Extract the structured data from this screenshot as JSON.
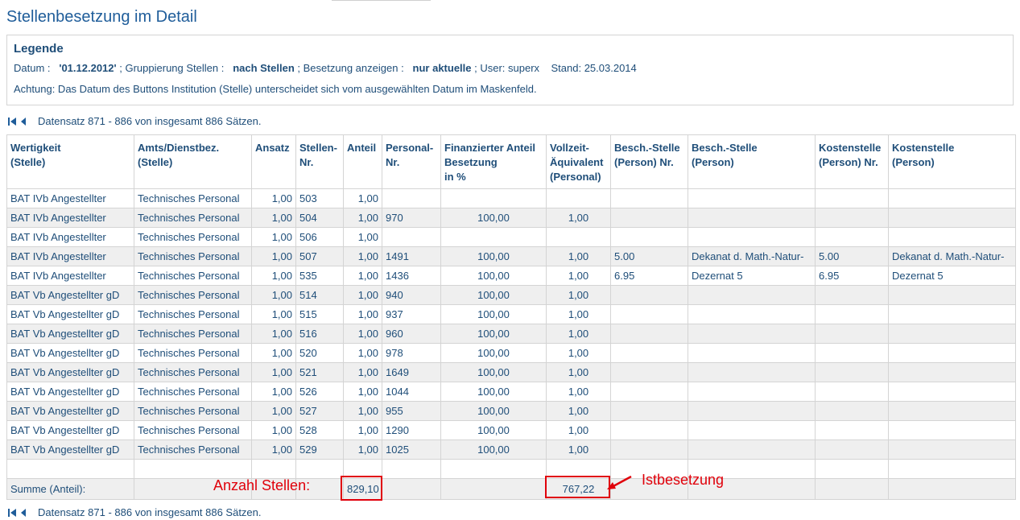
{
  "page": {
    "title": "Stellenbesetzung im Detail"
  },
  "legend": {
    "heading": "Legende",
    "datum_label": "Datum :",
    "datum_value": "'01.12.2012'",
    "sep1": ";",
    "gruppierung_label": "Gruppierung Stellen :",
    "gruppierung_value": "nach Stellen",
    "sep2": ";",
    "besetzung_label": "Besetzung anzeigen :",
    "besetzung_value": "nur aktuelle",
    "user_text": "; User: superx",
    "stand_text": "Stand: 25.03.2014",
    "note": "Achtung: Das Datum des Buttons Institution (Stelle) unterscheidet sich vom ausgewählten Datum im Maskenfeld."
  },
  "pager": {
    "text": "Datensatz 871 - 886 von insgesamt 886 Sätzen."
  },
  "table": {
    "headers": [
      [
        "Wertigkeit",
        "(Stelle)"
      ],
      [
        "Amts/Dienstbez.",
        "(Stelle)"
      ],
      [
        "Ansatz"
      ],
      [
        "Stellen-",
        "Nr."
      ],
      [
        "Anteil"
      ],
      [
        "Personal-",
        "Nr."
      ],
      [
        "Finanzierter Anteil",
        "Besetzung",
        "in %"
      ],
      [
        "Vollzeit-",
        "Äquivalent",
        "(Personal)"
      ],
      [
        "Besch.-Stelle",
        "(Person) Nr."
      ],
      [
        "Besch.-Stelle",
        "(Person)"
      ],
      [
        "Kostenstelle",
        "(Person) Nr."
      ],
      [
        "Kostenstelle",
        "(Person)"
      ]
    ],
    "rows": [
      [
        "BAT IVb Angestellter",
        "Technisches Personal",
        "1,00",
        "503",
        "1,00",
        "",
        "",
        "",
        "",
        "",
        "",
        ""
      ],
      [
        "BAT IVb Angestellter",
        "Technisches Personal",
        "1,00",
        "504",
        "1,00",
        "970",
        "100,00",
        "1,00",
        "",
        "",
        "",
        ""
      ],
      [
        "BAT IVb Angestellter",
        "Technisches Personal",
        "1,00",
        "506",
        "1,00",
        "",
        "",
        "",
        "",
        "",
        "",
        ""
      ],
      [
        "BAT IVb Angestellter",
        "Technisches Personal",
        "1,00",
        "507",
        "1,00",
        "1491",
        "100,00",
        "1,00",
        "5.00",
        "Dekanat d. Math.-Natur-",
        "5.00",
        "Dekanat d. Math.-Natur-"
      ],
      [
        "BAT IVb Angestellter",
        "Technisches Personal",
        "1,00",
        "535",
        "1,00",
        "1436",
        "100,00",
        "1,00",
        "6.95",
        "Dezernat 5",
        "6.95",
        "Dezernat 5"
      ],
      [
        "BAT Vb Angestellter gD",
        "Technisches Personal",
        "1,00",
        "514",
        "1,00",
        "940",
        "100,00",
        "1,00",
        "",
        "",
        "",
        ""
      ],
      [
        "BAT Vb Angestellter gD",
        "Technisches Personal",
        "1,00",
        "515",
        "1,00",
        "937",
        "100,00",
        "1,00",
        "",
        "",
        "",
        ""
      ],
      [
        "BAT Vb Angestellter gD",
        "Technisches Personal",
        "1,00",
        "516",
        "1,00",
        "960",
        "100,00",
        "1,00",
        "",
        "",
        "",
        ""
      ],
      [
        "BAT Vb Angestellter gD",
        "Technisches Personal",
        "1,00",
        "520",
        "1,00",
        "978",
        "100,00",
        "1,00",
        "",
        "",
        "",
        ""
      ],
      [
        "BAT Vb Angestellter gD",
        "Technisches Personal",
        "1,00",
        "521",
        "1,00",
        "1649",
        "100,00",
        "1,00",
        "",
        "",
        "",
        ""
      ],
      [
        "BAT Vb Angestellter gD",
        "Technisches Personal",
        "1,00",
        "526",
        "1,00",
        "1044",
        "100,00",
        "1,00",
        "",
        "",
        "",
        ""
      ],
      [
        "BAT Vb Angestellter gD",
        "Technisches Personal",
        "1,00",
        "527",
        "1,00",
        "955",
        "100,00",
        "1,00",
        "",
        "",
        "",
        ""
      ],
      [
        "BAT Vb Angestellter gD",
        "Technisches Personal",
        "1,00",
        "528",
        "1,00",
        "1290",
        "100,00",
        "1,00",
        "",
        "",
        "",
        ""
      ],
      [
        "BAT Vb Angestellter gD",
        "Technisches Personal",
        "1,00",
        "529",
        "1,00",
        "1025",
        "100,00",
        "1,00",
        "",
        "",
        "",
        ""
      ]
    ],
    "summary": {
      "label": "Summe (Anteil):",
      "anteil": "829,10",
      "vollzeit": "767,22"
    }
  },
  "annotations": {
    "anzahl_stellen": "Anzahl Stellen:",
    "istbesetzung": "Istbesetzung",
    "color": "#e0000a"
  },
  "colors": {
    "text": "#1f4e79",
    "title": "#1f5d9a",
    "row_alt": "#efefef",
    "border": "#d4d4d4"
  }
}
